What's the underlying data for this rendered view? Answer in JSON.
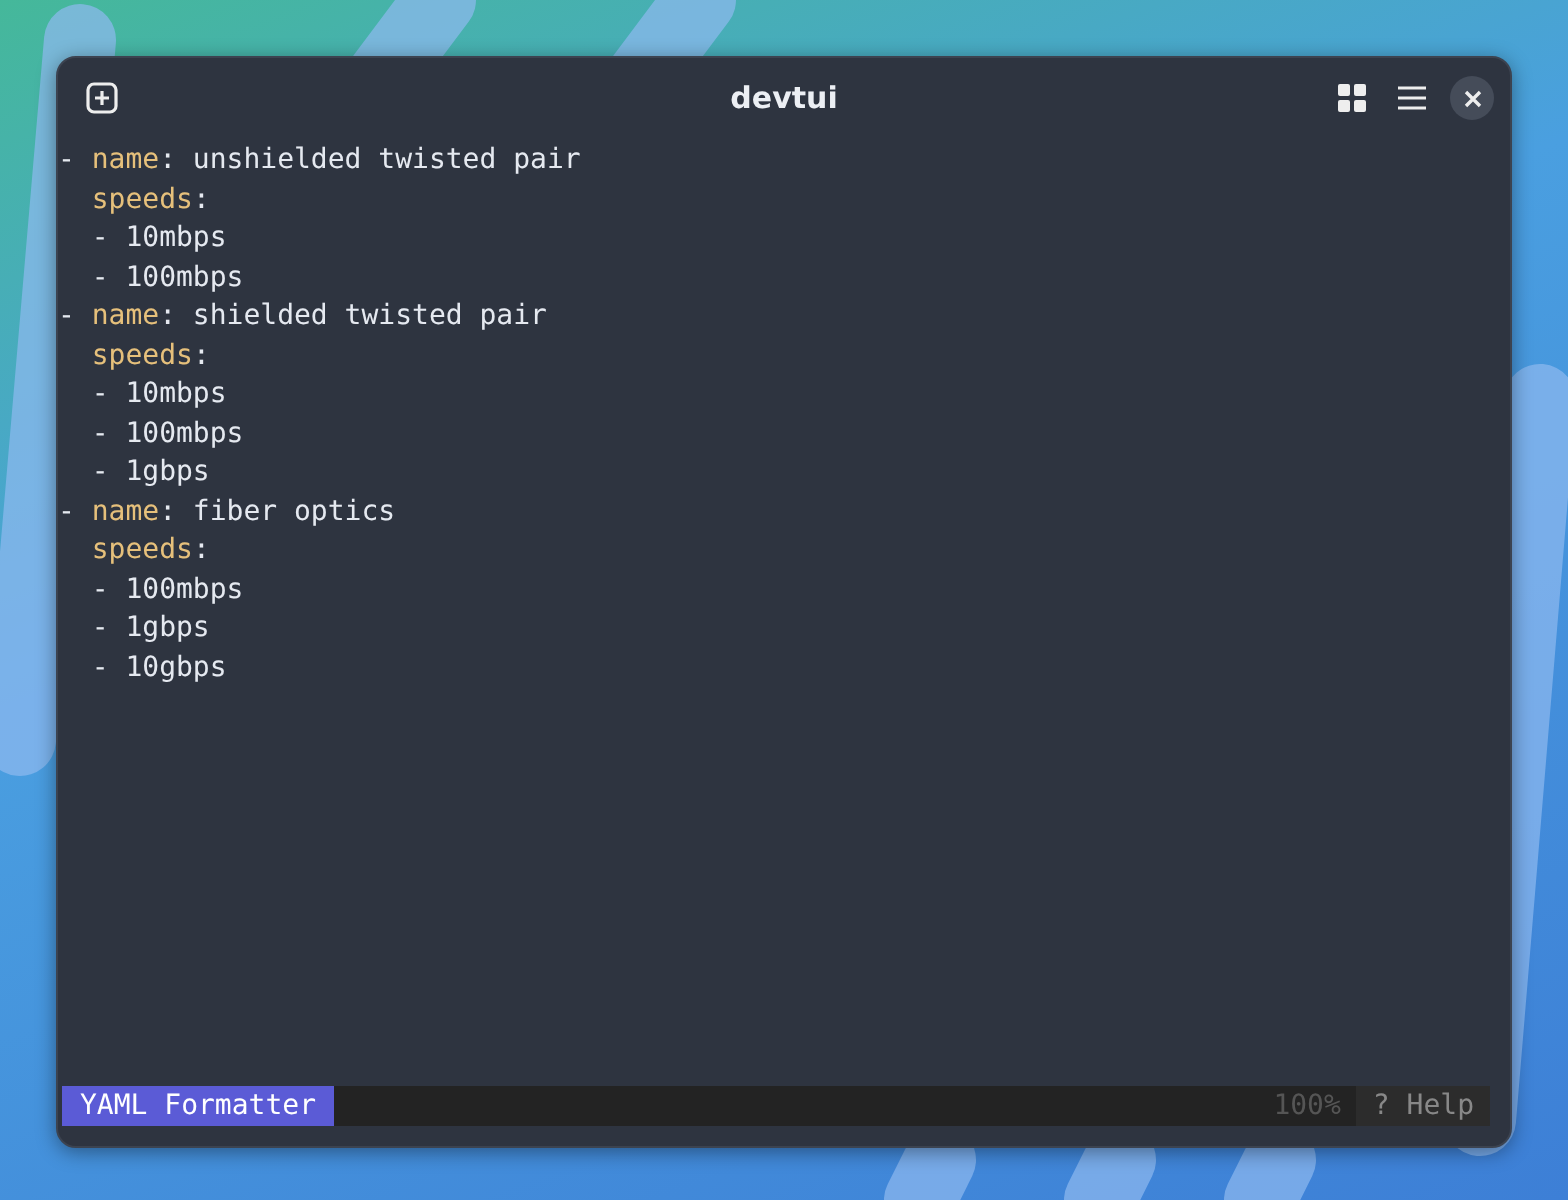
{
  "window": {
    "title": "devtui"
  },
  "lines": [
    {
      "kind": "key_value",
      "marker": "-",
      "key": "name",
      "colon": ":",
      "value": "unshielded twisted pair"
    },
    {
      "kind": "key",
      "key": "speeds",
      "colon": ":"
    },
    {
      "kind": "item",
      "marker": "-",
      "value": "10mbps"
    },
    {
      "kind": "item",
      "marker": "-",
      "value": "100mbps"
    },
    {
      "kind": "key_value",
      "marker": "-",
      "key": "name",
      "colon": ":",
      "value": "shielded twisted pair"
    },
    {
      "kind": "key",
      "key": "speeds",
      "colon": ":"
    },
    {
      "kind": "item",
      "marker": "-",
      "value": "10mbps"
    },
    {
      "kind": "item",
      "marker": "-",
      "value": "100mbps"
    },
    {
      "kind": "item",
      "marker": "-",
      "value": "1gbps"
    },
    {
      "kind": "key_value",
      "marker": "-",
      "key": "name",
      "colon": ":",
      "value": "fiber optics"
    },
    {
      "kind": "key",
      "key": "speeds",
      "colon": ":"
    },
    {
      "kind": "item",
      "marker": "-",
      "value": "100mbps"
    },
    {
      "kind": "item",
      "marker": "-",
      "value": "1gbps"
    },
    {
      "kind": "item",
      "marker": "-",
      "value": "10gbps"
    }
  ],
  "status_bar": {
    "mode": "YAML Formatter",
    "scroll": "100%",
    "help": "? Help"
  }
}
